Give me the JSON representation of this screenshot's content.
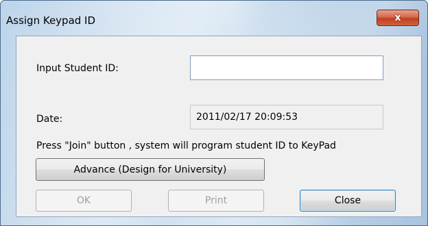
{
  "window": {
    "title": "Assign Keypad ID",
    "close_glyph": "x"
  },
  "form": {
    "student_id_label": "Input Student ID:",
    "student_id_value": "",
    "date_label": "Date:",
    "date_value": "2011/02/17 20:09:53",
    "instruction": "Press \"Join\" button , system will program student ID to KeyPad"
  },
  "buttons": {
    "advance_label": "Advance (Design for University)",
    "ok_label": "OK",
    "print_label": "Print",
    "close_label": "Close"
  }
}
